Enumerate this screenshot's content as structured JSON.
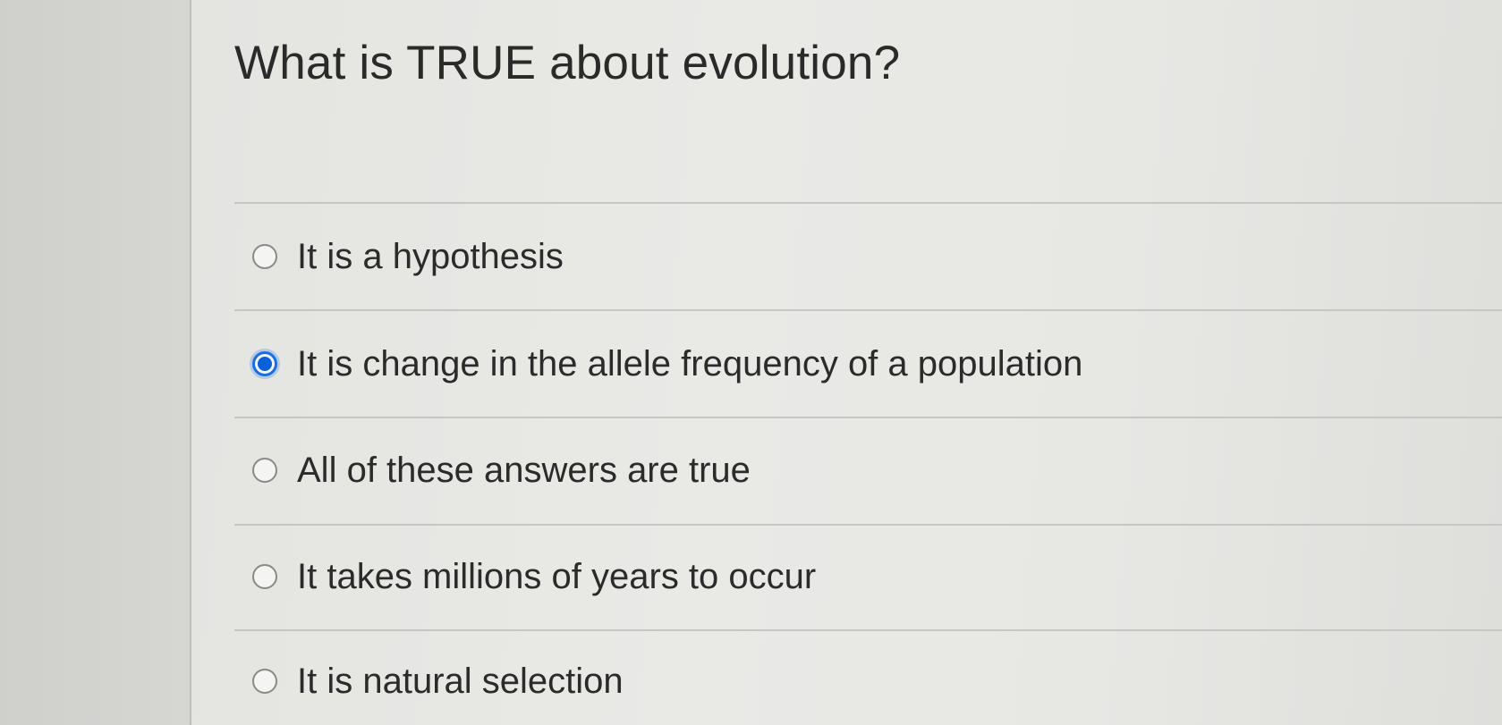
{
  "question": {
    "title": "What is TRUE about evolution?"
  },
  "options": [
    {
      "label": "It is a hypothesis",
      "selected": false
    },
    {
      "label": "It is change in the allele frequency of a population",
      "selected": true
    },
    {
      "label": "All of these answers are true",
      "selected": false
    },
    {
      "label": "It takes millions of years to occur",
      "selected": false
    },
    {
      "label": "It is natural selection",
      "selected": false
    }
  ],
  "colors": {
    "accent": "#0b5fd8",
    "background": "#e6e6e3",
    "text": "#2b2b2b"
  }
}
